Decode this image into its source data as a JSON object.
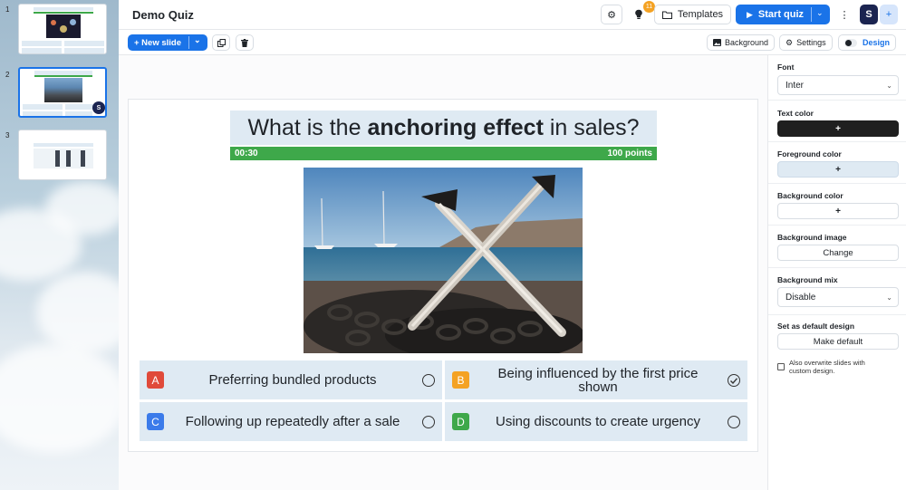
{
  "app": {
    "title": "Demo Quiz"
  },
  "topbar": {
    "notification_count": "11",
    "templates_label": "Templates",
    "start_label": "Start quiz",
    "avatar_initial": "S",
    "add_label": "+"
  },
  "toolbar": {
    "new_slide_label": "+ New slide",
    "background_label": "Background",
    "settings_label": "Settings",
    "design_label": "Design"
  },
  "slides": [
    {
      "number": "1"
    },
    {
      "number": "2"
    },
    {
      "number": "3"
    }
  ],
  "question": {
    "prefix": "What is the ",
    "emphasis": "anchoring effect",
    "suffix": " in sales?",
    "timer": "00:30",
    "points": "100 points"
  },
  "answers": [
    {
      "letter": "A",
      "text": "Preferring bundled products",
      "color": "#e04a3a",
      "correct": false
    },
    {
      "letter": "B",
      "text": "Being influenced by the first price shown",
      "color": "#f4a223",
      "correct": true
    },
    {
      "letter": "C",
      "text": "Following up repeatedly after a sale",
      "color": "#3b7bea",
      "correct": false
    },
    {
      "letter": "D",
      "text": "Using discounts to create urgency",
      "color": "#3ea84a",
      "correct": false
    }
  ],
  "panel": {
    "font_label": "Font",
    "font_value": "Inter",
    "text_color_label": "Text color",
    "foreground_color_label": "Foreground color",
    "background_color_label": "Background color",
    "background_image_label": "Background image",
    "change_label": "Change",
    "background_mix_label": "Background mix",
    "background_mix_value": "Disable",
    "default_design_label": "Set as default design",
    "make_default_label": "Make default",
    "overwrite_label": "Also overwrite slides with custom design.",
    "plus": "+"
  },
  "colors": {
    "accent": "#1a73e8",
    "text_color_swatch": "#1f1f1f",
    "foreground_swatch": "#dfeaf3",
    "timer_green": "#3ea84a"
  }
}
